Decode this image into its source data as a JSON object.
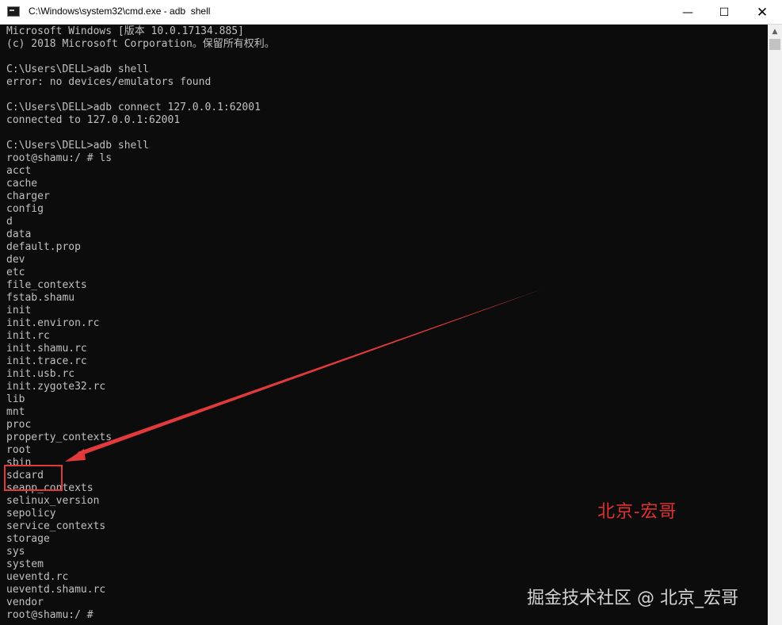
{
  "window": {
    "title": "C:\\Windows\\system32\\cmd.exe - adb  shell",
    "controls": {
      "minimize": "—",
      "maximize": "☐",
      "close": "✕"
    }
  },
  "console": {
    "lines": [
      "Microsoft Windows [版本 10.0.17134.885]",
      "(c) 2018 Microsoft Corporation。保留所有权利。",
      "",
      "C:\\Users\\DELL>adb shell",
      "error: no devices/emulators found",
      "",
      "C:\\Users\\DELL>adb connect 127.0.0.1:62001",
      "connected to 127.0.0.1:62001",
      "",
      "C:\\Users\\DELL>adb shell",
      "root@shamu:/ # ls",
      "acct",
      "cache",
      "charger",
      "config",
      "d",
      "data",
      "default.prop",
      "dev",
      "etc",
      "file_contexts",
      "fstab.shamu",
      "init",
      "init.environ.rc",
      "init.rc",
      "init.shamu.rc",
      "init.trace.rc",
      "init.usb.rc",
      "init.zygote32.rc",
      "lib",
      "mnt",
      "proc",
      "property_contexts",
      "root",
      "sbin",
      "sdcard",
      "seapp_contexts",
      "selinux_version",
      "sepolicy",
      "service_contexts",
      "storage",
      "sys",
      "system",
      "ueventd.rc",
      "ueventd.shamu.rc",
      "vendor",
      "root@shamu:/ #"
    ]
  },
  "annotation": {
    "note": "北京-宏哥",
    "highlight_color": "#e23a3a"
  },
  "watermark": "掘金技术社区 @ 北京_宏哥"
}
